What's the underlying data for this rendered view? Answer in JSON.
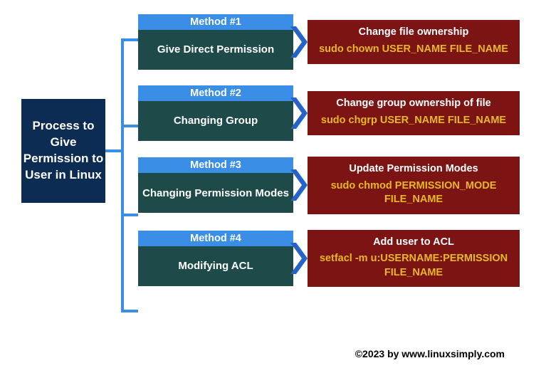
{
  "root_label": "Process to Give Permission to User in Linux",
  "methods": [
    {
      "header": "Method #1",
      "body": "Give Direct Permission",
      "result_title": "Change file ownership",
      "result_cmd": "sudo chown USER_NAME FILE_NAME"
    },
    {
      "header": "Method #2",
      "body": "Changing Group",
      "result_title": "Change group ownership of file",
      "result_cmd": "sudo chgrp USER_NAME FILE_NAME"
    },
    {
      "header": "Method #3",
      "body": "Changing Permission Modes",
      "result_title": "Update Permission Modes",
      "result_cmd": "sudo chmod PERMISSION_MODE FILE_NAME"
    },
    {
      "header": "Method #4",
      "body": "Modifying ACL",
      "result_title": "Add user to ACL",
      "result_cmd": "setfacl -m u:USERNAME:PERMISSION FILE_NAME"
    }
  ],
  "footer": "©2023 by www.linuxsimply.com",
  "colors": {
    "root_bg": "#0d2c54",
    "header_bg": "#3b8ee6",
    "body_bg": "#1e4a4a",
    "result_bg": "#7c1414",
    "cmd_fg": "#e6b822",
    "line": "#3b8ee6"
  }
}
